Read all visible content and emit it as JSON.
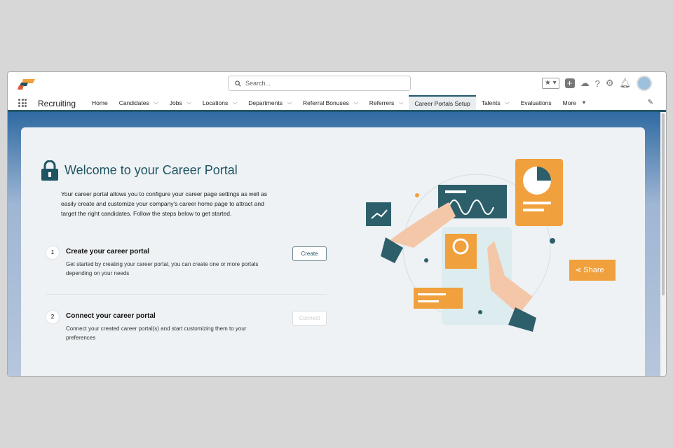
{
  "header": {
    "search_placeholder": "Search...",
    "app_name": "Recruiting"
  },
  "nav": {
    "tabs": [
      {
        "label": "Home",
        "dropdown": false
      },
      {
        "label": "Candidates",
        "dropdown": true
      },
      {
        "label": "Jobs",
        "dropdown": true
      },
      {
        "label": "Locations",
        "dropdown": true
      },
      {
        "label": "Departments",
        "dropdown": true
      },
      {
        "label": "Referral Bonuses",
        "dropdown": true
      },
      {
        "label": "Referrers",
        "dropdown": true
      },
      {
        "label": "Career Portals Setup",
        "dropdown": false,
        "active": true
      },
      {
        "label": "Talents",
        "dropdown": true
      },
      {
        "label": "Evaluations",
        "dropdown": false
      }
    ],
    "more": "More"
  },
  "main": {
    "title": "Welcome to your Career Portal",
    "intro": "Your career portal allows you to configure your career page settings as well as easily create and customize your company's career home page to attract and target the right candidates. Follow the steps below to get started.",
    "steps": [
      {
        "num": "1",
        "title": "Create your career portal",
        "desc": "Get started by creating your career portal, you can create one or more portals depending on your needs",
        "button": "Create"
      },
      {
        "num": "2",
        "title": "Connect your career portal",
        "desc": "Connect your created career portal(s) and start customizing them to your preferences",
        "button": "Connect"
      }
    ],
    "illustration": {
      "share_label": "Share"
    }
  },
  "colors": {
    "accent": "#1f5463",
    "orange": "#f0a03c"
  }
}
